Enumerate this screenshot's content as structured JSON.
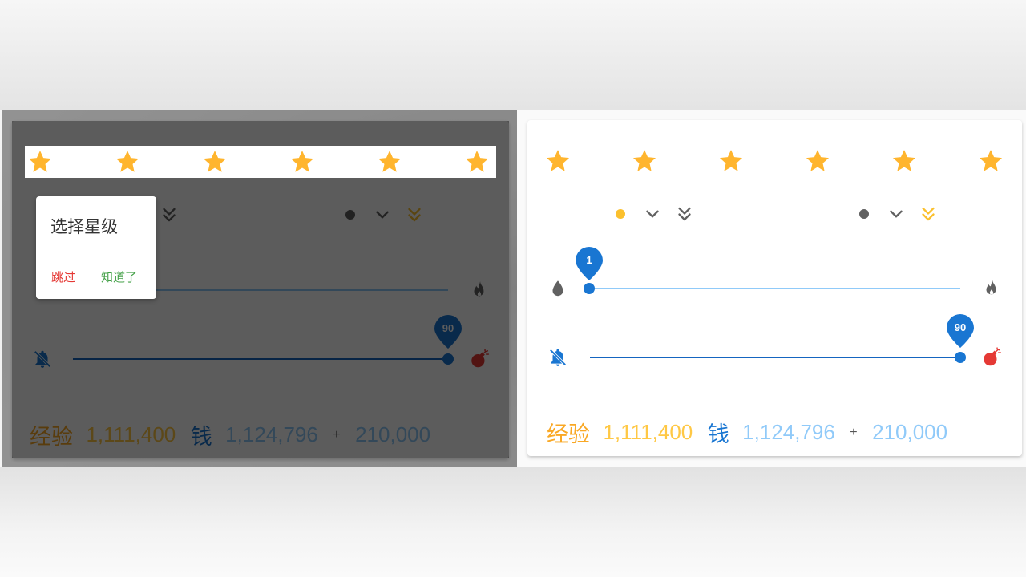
{
  "rating_header": {
    "star_count": 6,
    "star_color": "#ffb52e",
    "star_icon": "star-icon"
  },
  "icon_colors": {
    "grey": "#616161",
    "yellow": "#fbc02d",
    "blue": "#1976d2",
    "red": "#e53935"
  },
  "slider_small": {
    "value_text": "1",
    "value": 1,
    "min": 1,
    "max": 90,
    "start_icon": "water-drop-icon",
    "end_icon": "fire-icon",
    "track_color": "#90caf9"
  },
  "slider_large": {
    "value_text": "90",
    "value": 90,
    "min": 1,
    "max": 90,
    "start_icon": "no-bell-icon",
    "end_icon": "bomb-icon",
    "track_color": "#1565c0"
  },
  "stats": {
    "exp_label": "经验",
    "exp_value": "1,111,400",
    "money_label": "钱",
    "money_value": "1,124,796",
    "plus_sign": "+",
    "bonus_value": "210,000"
  },
  "tutorial_popover": {
    "title": "选择星级",
    "skip_label": "跳过",
    "ok_label": "知道了"
  }
}
